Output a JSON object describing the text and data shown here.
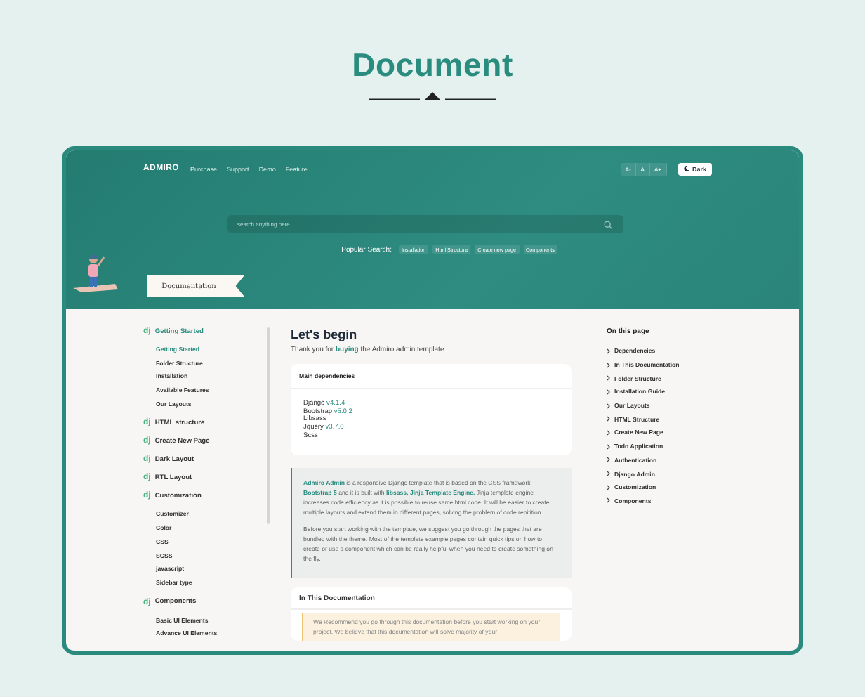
{
  "page_title": "Document",
  "header": {
    "logo": "ADMIRO",
    "nav": [
      "Purchase",
      "Support",
      "Demo",
      "Feature"
    ],
    "font_buttons": [
      "A-",
      "A",
      "A+"
    ],
    "theme_button": "Dark",
    "search": {
      "placeholder": "search anything here"
    },
    "popular_label": "Popular Search:",
    "popular_tags": [
      "Installation",
      "Html Structure",
      "Create new page",
      "Components"
    ],
    "banner_label": "Documentation"
  },
  "sidebar": {
    "groups": [
      {
        "badge": "dj",
        "label": "Getting Started",
        "selected": true,
        "children": [
          {
            "label": "Getting Started",
            "selected": true
          },
          {
            "label": "Folder Structure",
            "selected": false
          },
          {
            "label": "Installation",
            "selected": false
          },
          {
            "label": "Available Features",
            "selected": false
          },
          {
            "label": "Our Layouts",
            "selected": false
          }
        ]
      },
      {
        "badge": "dj",
        "label": "HTML structure",
        "selected": false
      },
      {
        "badge": "dj",
        "label": "Create New Page",
        "selected": false
      },
      {
        "badge": "dj",
        "label": "Dark Layout",
        "selected": false
      },
      {
        "badge": "dj",
        "label": "RTL Layout",
        "selected": false
      },
      {
        "badge": "dj",
        "label": "Customization",
        "selected": false,
        "children": [
          {
            "label": "Customizer",
            "selected": false
          },
          {
            "label": "Color",
            "selected": false
          },
          {
            "label": "CSS",
            "selected": false
          },
          {
            "label": "SCSS",
            "selected": false
          },
          {
            "label": "javascript",
            "selected": false
          },
          {
            "label": "Sidebar type",
            "selected": false
          }
        ]
      },
      {
        "badge": "dj",
        "label": "Components",
        "selected": false,
        "children": [
          {
            "label": "Basic UI Elements",
            "selected": false
          },
          {
            "label": "Advance UI Elements",
            "selected": false
          }
        ]
      }
    ]
  },
  "main": {
    "heading": "Let's begin",
    "intro": "Thank you for **buying** the Admiro admin template",
    "dependencies": {
      "title": "Main dependencies",
      "items": [
        {
          "name": "Django",
          "version": "v4.1.4"
        },
        {
          "name": "Bootstrap",
          "version": "v5.0.2"
        },
        {
          "name": "Libsass"
        },
        {
          "name": "Jquery",
          "version": "v3.7.0"
        },
        {
          "name": "Scss"
        }
      ]
    },
    "callout": [
      "**Admiro Admin** is a responsive Django template that is based on the CSS framework **Bootstrap 5** and it is built with **libsass, Jinja Template Engine.** Jinja template engine increases code efficiency as it is possible to reuse same html code. It will be easier to create multiple layouts and extend them in different pages, solving the problem of code repitition.",
      "Before you start working with the template, we suggest you go through the pages that are bundled with the theme. Most of the template example pages contain quick tips on how to create or use a component which can be really helpful when you need to create something on the fly."
    ],
    "section": {
      "title": "In This Documentation",
      "note": "We Recommend you go through this documentation before you start working on your project. We believe that this documentation will solve majority of your"
    }
  },
  "toc": {
    "title": "On this page",
    "items": [
      "Dependencies",
      "In This Documentation",
      "Folder Structure",
      "Installation Guide",
      "Our Layouts",
      "HTML Structure",
      "Create New Page",
      "Todo Application",
      "Authentication",
      "Django Admin",
      "Customization",
      "Components"
    ]
  }
}
